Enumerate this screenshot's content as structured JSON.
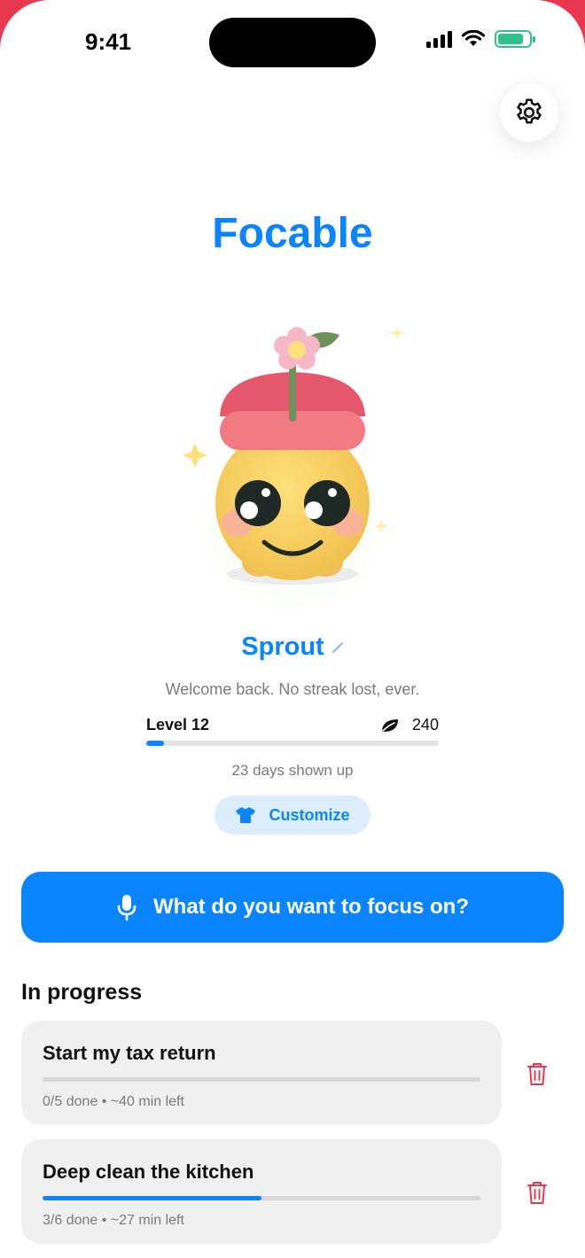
{
  "status_bar": {
    "time": "9:41"
  },
  "app": {
    "title": "Focable"
  },
  "pet": {
    "name": "Sprout"
  },
  "welcome_text": "Welcome back. No streak lost, ever.",
  "level": {
    "label": "Level 12",
    "progress": 0.06,
    "coins": "240"
  },
  "streak_text": "23 days shown up",
  "customize": {
    "label": "Customize"
  },
  "focus_prompt": {
    "label": "What do you want to focus on?"
  },
  "in_progress": {
    "title": "In progress",
    "tasks": [
      {
        "title": "Start my tax return",
        "progress": 0.0,
        "meta": "0/5 done • ~40 min left"
      },
      {
        "title": "Deep clean the kitchen",
        "progress": 0.5,
        "meta": "3/6 done • ~27 min left"
      }
    ]
  },
  "colors": {
    "accent": "#0a84ff",
    "danger": "#e8374f",
    "battery": "#33c08a"
  },
  "icons": [
    "gear-icon",
    "edit-icon",
    "leaf-icon",
    "tshirt-icon",
    "microphone-icon",
    "trash-icon",
    "signal-icon",
    "wifi-icon",
    "battery-icon"
  ]
}
